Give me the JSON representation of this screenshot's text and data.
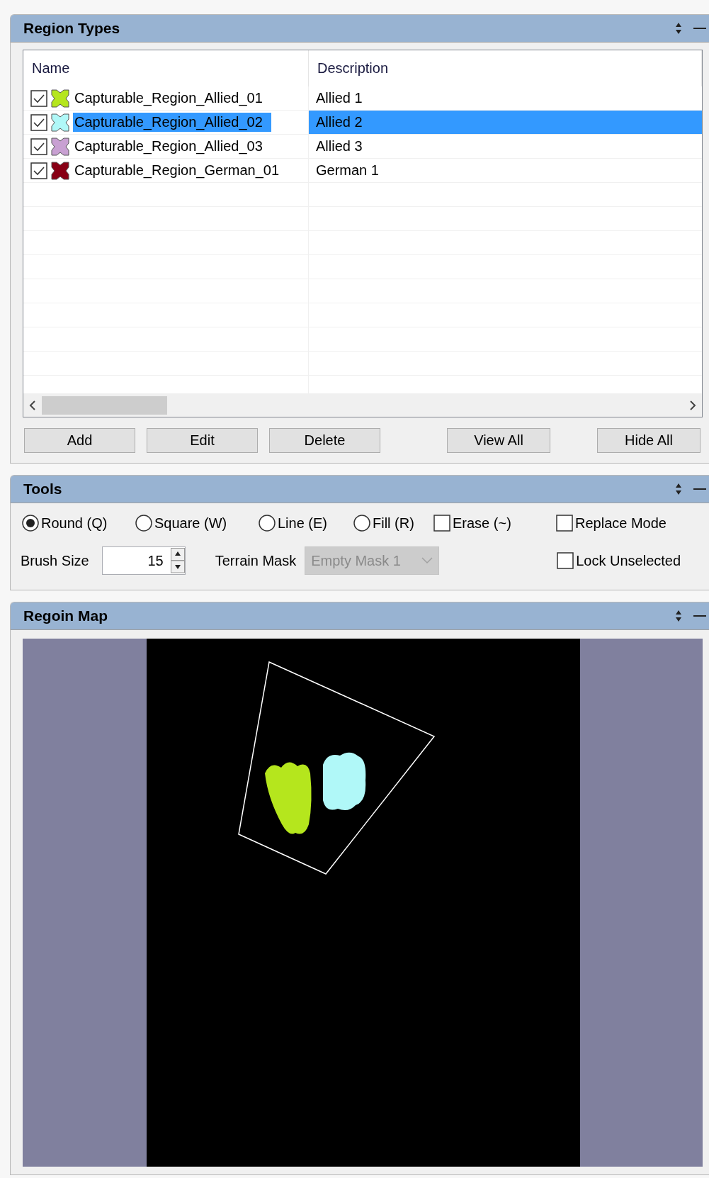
{
  "region_types": {
    "title": "Region Types",
    "columns": [
      "Name",
      "Description"
    ],
    "rows": [
      {
        "checked": true,
        "color": "#b5e61d",
        "name": "Capturable_Region_Allied_01",
        "description": "Allied 1",
        "selected": false
      },
      {
        "checked": true,
        "color": "#b0f8f8",
        "name": "Capturable_Region_Allied_02",
        "description": "Allied 2",
        "selected": true
      },
      {
        "checked": true,
        "color": "#c8a0d2",
        "name": "Capturable_Region_Allied_03",
        "description": "Allied 3",
        "selected": false
      },
      {
        "checked": true,
        "color": "#880015",
        "name": "Capturable_Region_German_01",
        "description": "German 1",
        "selected": false
      }
    ],
    "buttons": [
      "Add",
      "Edit",
      "Delete",
      "View All",
      "Hide All"
    ]
  },
  "tools": {
    "title": "Tools",
    "brushes": [
      {
        "label": "Round (Q)",
        "selected": true
      },
      {
        "label": "Square (W)",
        "selected": false
      },
      {
        "label": "Line (E)",
        "selected": false
      },
      {
        "label": "Fill (R)",
        "selected": false
      }
    ],
    "erase": {
      "label": "Erase (~)",
      "checked": false
    },
    "replace_mode": {
      "label": "Replace Mode",
      "checked": false
    },
    "brush_size": {
      "label": "Brush Size",
      "value": "15"
    },
    "terrain_mask": {
      "label": "Terrain Mask",
      "value": "Empty Mask 1",
      "disabled": true
    },
    "lock_unselected": {
      "label": "Lock Unselected",
      "checked": false
    }
  },
  "region_map": {
    "title": "Regoin Map"
  }
}
